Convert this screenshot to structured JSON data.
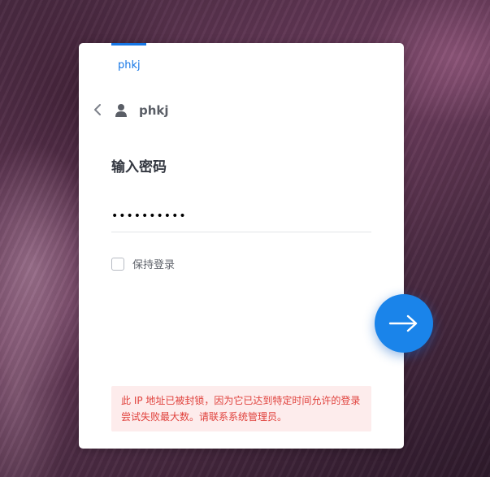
{
  "tab": {
    "label": "phkj"
  },
  "account": {
    "name": "phkj"
  },
  "login": {
    "heading": "输入密码",
    "password_value": "••••••••••",
    "remember_label": "保持登录",
    "remember_checked": false
  },
  "error": {
    "message": "此 IP 地址已被封锁，因为它已达到特定时间允许的登录尝试失败最大数。请联系系统管理员。"
  },
  "icons": {
    "back": "chevron-left-icon",
    "user": "user-icon",
    "next": "arrow-right-icon"
  },
  "colors": {
    "accent": "#1677e6",
    "error_text": "#e0413c",
    "error_bg": "#fdecec"
  }
}
